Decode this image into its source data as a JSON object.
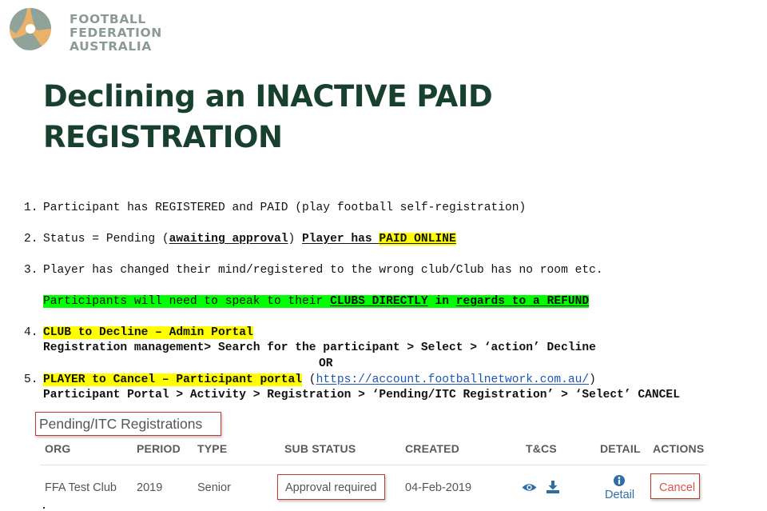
{
  "logo": {
    "line1": "FOOTBALL",
    "line2": "FEDERATION",
    "line3": "AUSTRALIA"
  },
  "title": {
    "line1": "Declining an INACTIVE PAID",
    "line2": "REGISTRATION"
  },
  "steps": {
    "s1": {
      "num": "1.",
      "text": "Participant has REGISTERED and PAID (play football self-registration)"
    },
    "s2": {
      "num": "2.",
      "prefix": "Status = Pending (",
      "awaiting": "awaiting approval",
      "mid": ") ",
      "player_has": "Player has ",
      "paid_online": "PAID ONLINE"
    },
    "s3": {
      "num": "3.",
      "text": "Player has changed their mind/registered to the wrong club/Club has no room etc."
    },
    "refund_note": {
      "prefix": "Participants will need to speak to their ",
      "clubs_directly": "CLUBS DIRECTLY",
      "in": " in ",
      "regards": "regards",
      "to_a_refund": " to a REFUND"
    },
    "s4": {
      "num": "4.",
      "heading": "CLUB to Decline – Admin Portal",
      "path": "Registration management> Search for the participant > Select > ‘action’ Decline"
    },
    "or": "OR",
    "s5": {
      "num": "5.",
      "heading": "PLAYER to Cancel – Participant portal",
      "open_paren": " (",
      "url": "https://account.footballnetwork.com.au/",
      "close_paren": ")",
      "path": "Participant Portal > Activity > Registration > ‘Pending/ITC Registration’ > ‘Select’ CANCEL"
    }
  },
  "panel": {
    "title": "Pending/ITC Registrations",
    "columns": {
      "org": "ORG",
      "period": "PERIOD",
      "type": "TYPE",
      "sub_status": "SUB STATUS",
      "created": "CREATED",
      "tcs": "T&CS",
      "detail": "DETAIL",
      "actions": "ACTIONS"
    },
    "row": {
      "org": "FFA Test Club",
      "period": "2019",
      "type": "Senior",
      "sub_status": "Approval required",
      "created": "04-Feb-2019",
      "detail": "Detail",
      "action": "Cancel"
    }
  },
  "icons": {
    "logo": "ffa-logo-icon",
    "view": "eye-icon",
    "download": "download-icon",
    "info": "info-icon"
  },
  "colors": {
    "title": "#17402f",
    "highlight_yellow": "#ffff00",
    "highlight_green": "#00ff00",
    "link": "#1b56b5",
    "callout_border": "#c0392b",
    "cancel": "#d9534f",
    "action_blue": "#2e6ea6"
  }
}
